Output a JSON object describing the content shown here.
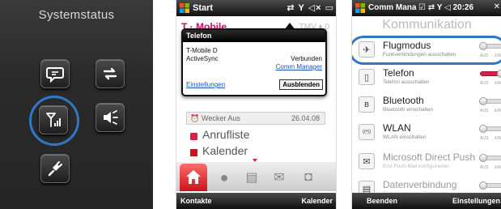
{
  "panel1": {
    "title": "Systemstatus",
    "tiles": [
      "message-icon",
      "sync-icon",
      "signal-icon",
      "volume-icon",
      "plug-icon"
    ]
  },
  "panel2": {
    "status": {
      "start": "Start",
      "icons": "⇄ Y ◁× ▭"
    },
    "background_brand": "T · Mobile",
    "background_brand_right": "TMV ♦ 0",
    "popup": {
      "title": "Telefon",
      "line1": "T-Mobile D",
      "line2_label": "ActiveSync",
      "line2_value": "Verbunden",
      "link_right": "Comm Manager",
      "link_left": "Einstellungen",
      "button": "Ausblenden"
    },
    "wecker": {
      "label": "Wecker Aus",
      "date": "26.04.08"
    },
    "items": [
      "Anrufliste",
      "Kalender"
    ],
    "softkeys": {
      "left": "Kontakte",
      "right": "Kalender"
    }
  },
  "panel3": {
    "status": {
      "app": "Comm Mana",
      "icons": "☑ ⇄ Y ◁ 20:26",
      "close": "✕"
    },
    "title": "Kommunikation",
    "items": [
      {
        "name": "Flugmodus",
        "desc": "Funkverbindungen ausschalten",
        "on": false,
        "icon": "airplane-icon"
      },
      {
        "name": "Telefon",
        "desc": "Telefon ausschalten",
        "on": true,
        "icon": "phone-icon"
      },
      {
        "name": "Bluetooth",
        "desc": "Bluetooth einschalten",
        "on": false,
        "icon": "bluetooth-icon"
      },
      {
        "name": "WLAN",
        "desc": "WLAN einschalten",
        "on": false,
        "icon": "wifi-icon"
      },
      {
        "name": "Microsoft Direct Push",
        "desc": "Erst Push-Mail konfigurieren",
        "on": false,
        "icon": "push-mail-icon",
        "dim": true
      },
      {
        "name": "Datenverbindung",
        "desc": "Es besteht keine Datenverb.",
        "on": false,
        "icon": "data-icon",
        "dim": true
      }
    ],
    "toggle_labels": {
      "off": "AUS",
      "on": "EIN"
    },
    "softkeys": {
      "left": "Beenden",
      "right": "Einstellungen"
    }
  },
  "colors": {
    "accent_blue": "#2f78c8",
    "brand_magenta": "#d40a6b",
    "toggle_on": "#d8204a",
    "tab_active": "#c9151a"
  }
}
